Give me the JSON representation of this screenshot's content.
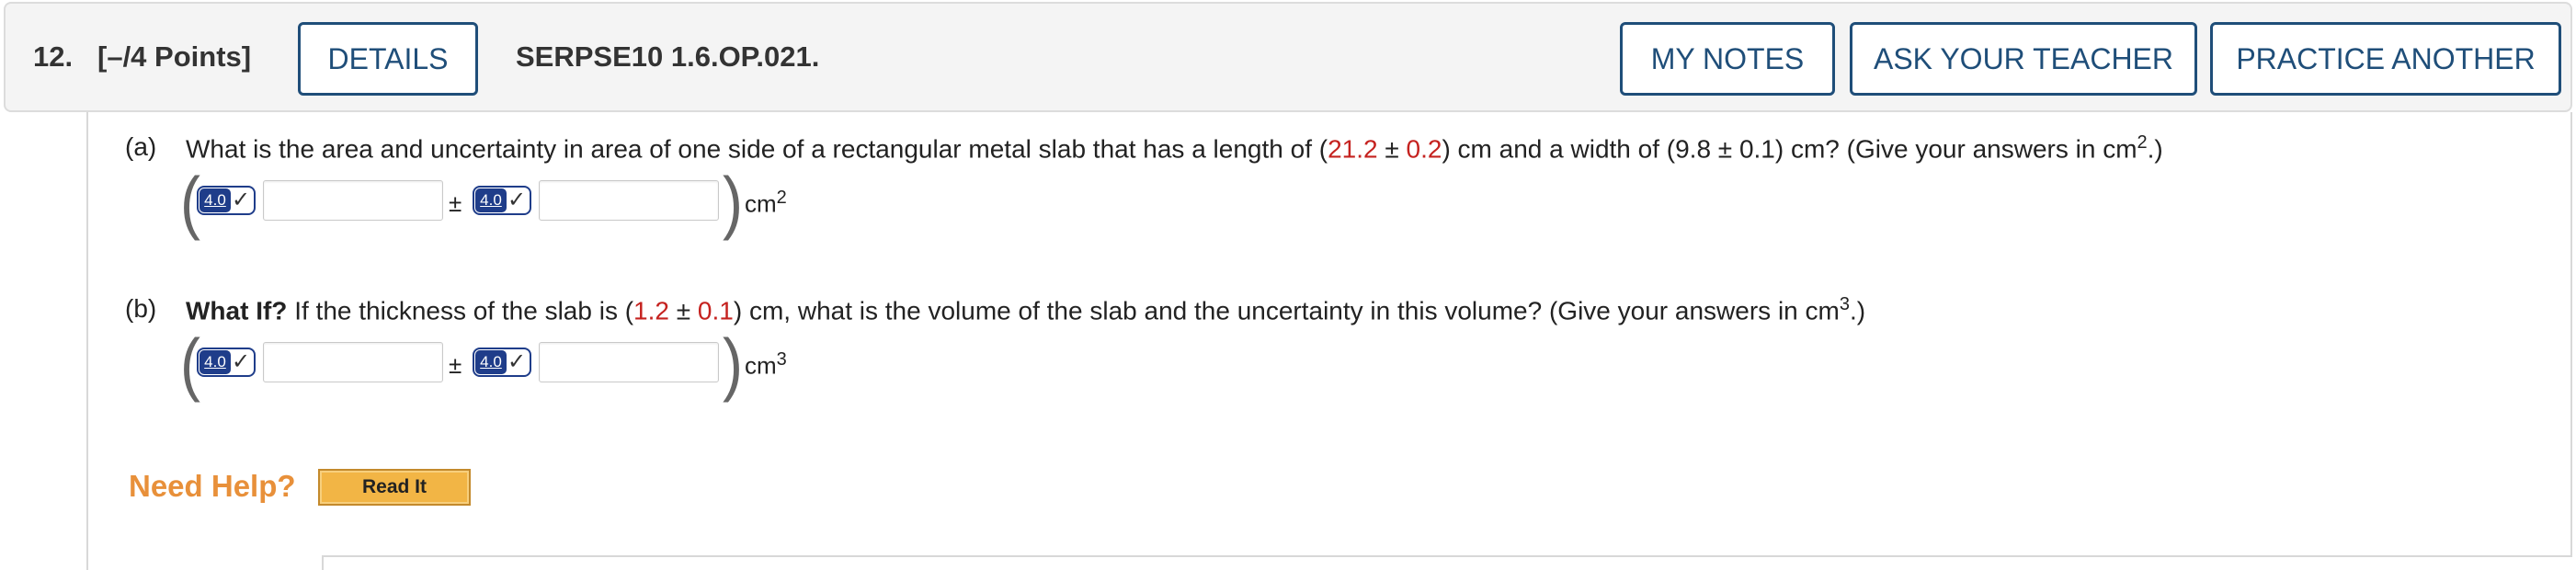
{
  "header": {
    "question_number": "12.",
    "points": "[–/4 Points]",
    "details_label": "DETAILS",
    "code": "SERPSE10 1.6.OP.021.",
    "notes_label": "MY NOTES",
    "teacher_label": "ASK YOUR TEACHER",
    "practice_label": "PRACTICE ANOTHER"
  },
  "part_a": {
    "letter": "(a)",
    "text_1": "What is the area and uncertainty in area of one side of a rectangular metal slab that has a length of (",
    "length_value": "21.2",
    "text_2": " ± ",
    "length_unc": "0.2",
    "text_3": ") cm and a width of (9.8 ± 0.1) cm? (Give your answers in cm",
    "sup": "2",
    "text_4": ".)",
    "badge_value": "4.0",
    "pm": "±",
    "unit": "cm",
    "unit_sup": "2",
    "value_input": "",
    "unc_input": ""
  },
  "part_b": {
    "letter": "(b)",
    "bold": "What If?",
    "text_1": " If the thickness of the slab is (",
    "thick_value": "1.2",
    "text_2": " ± ",
    "thick_unc": "0.1",
    "text_3": ") cm, what is the volume of the slab and the uncertainty in this volume? (Give your answers in cm",
    "sup": "3",
    "text_4": ".)",
    "badge_value": "4.0",
    "pm": "±",
    "unit": "cm",
    "unit_sup": "3",
    "value_input": "",
    "unc_input": ""
  },
  "help": {
    "need_help": "Need Help?",
    "read_it": "Read It"
  },
  "colors": {
    "accent": "#1f4e79",
    "given_value": "#c5221f",
    "help": "#e8903a"
  }
}
